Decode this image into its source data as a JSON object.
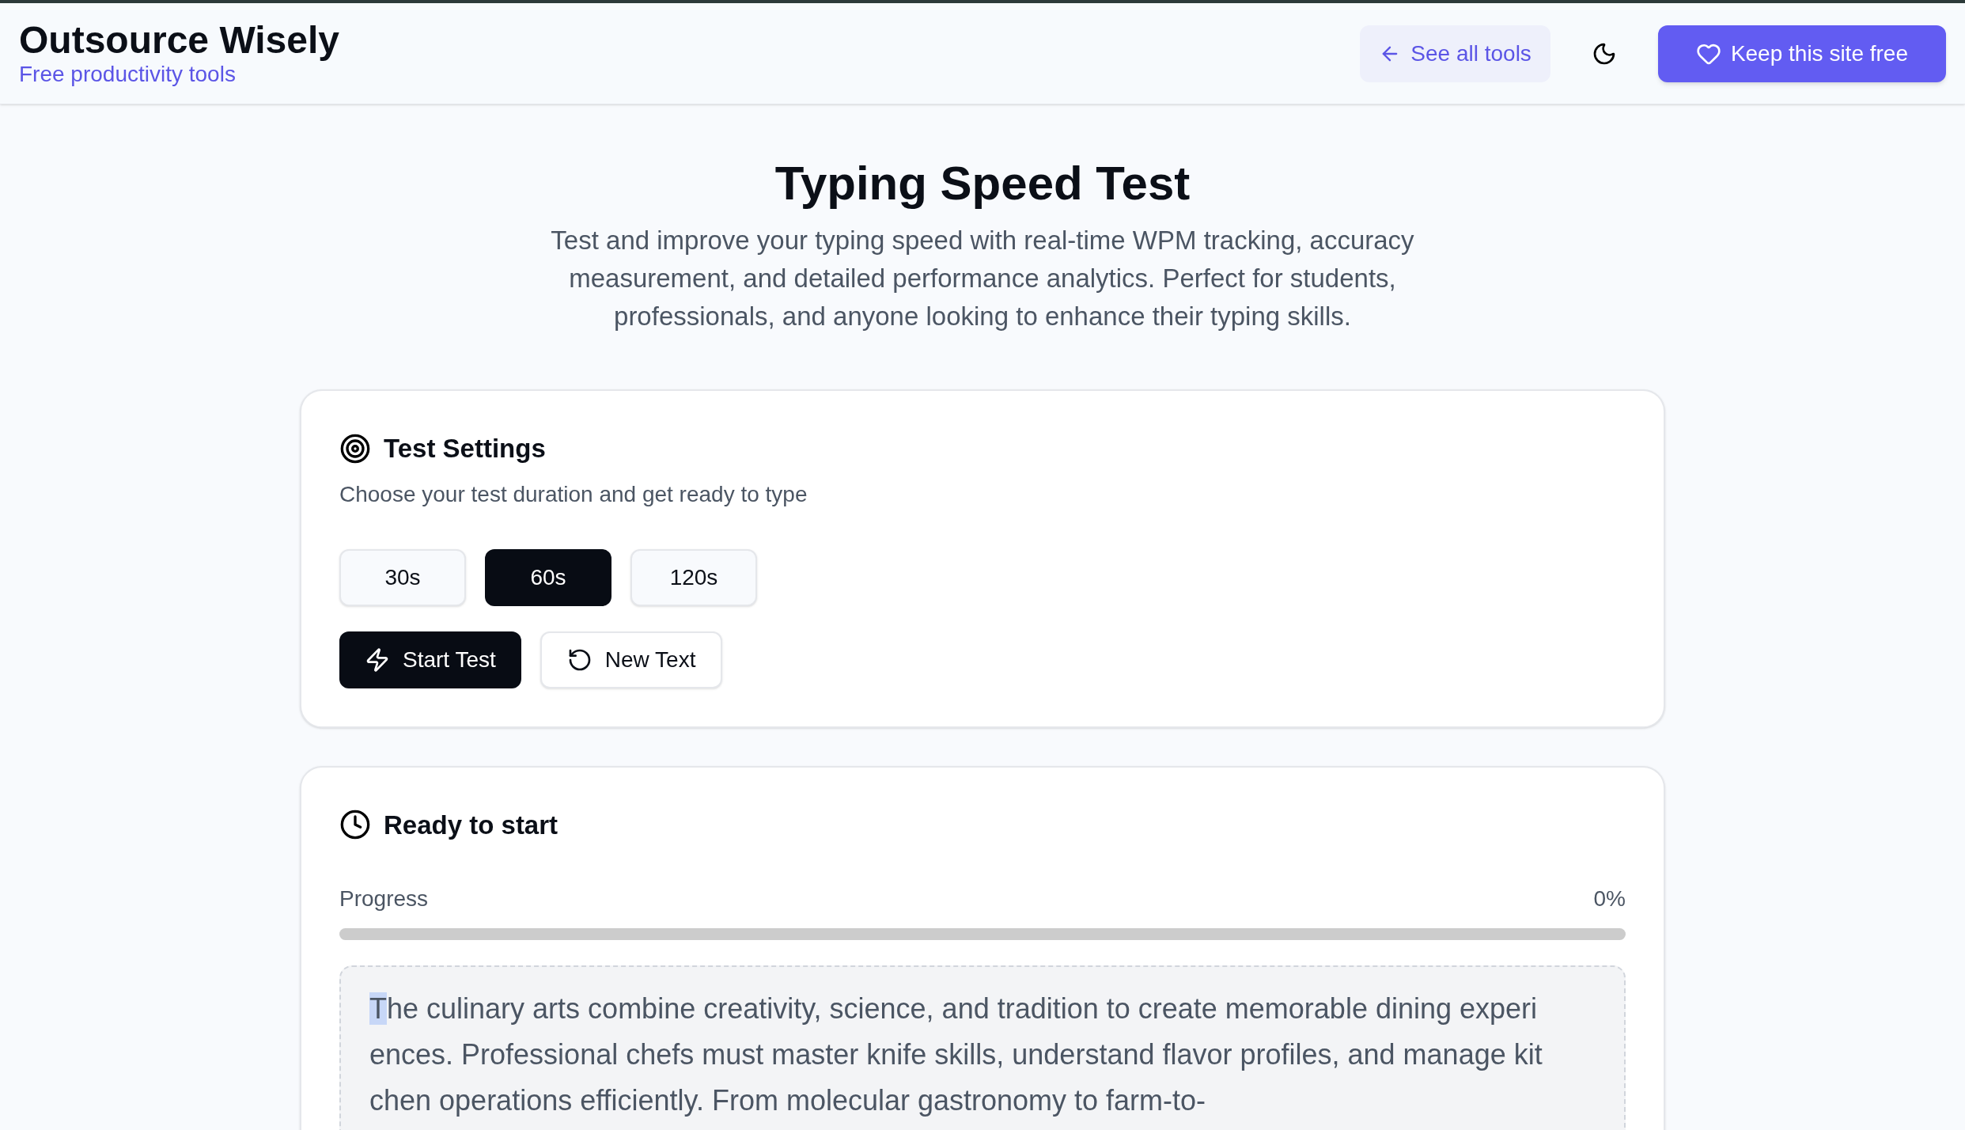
{
  "header": {
    "brand": "Outsource Wisely",
    "tagline": "Free productivity tools",
    "back_link": "See all tools",
    "support_button": "Keep this site free"
  },
  "hero": {
    "title": "Typing Speed Test",
    "description": "Test and improve your typing speed with real-time WPM tracking, accuracy measurement, and detailed performance analytics. Perfect for students, professionals, and anyone looking to enhance their typing skills."
  },
  "settings": {
    "title": "Test Settings",
    "subtitle": "Choose your test duration and get ready to type",
    "durations": [
      {
        "label": "30s",
        "selected": false
      },
      {
        "label": "60s",
        "selected": true
      },
      {
        "label": "120s",
        "selected": false
      }
    ],
    "actions": [
      {
        "label": "Start Test",
        "kind": "primary"
      },
      {
        "label": "New Text",
        "kind": "secondary"
      }
    ]
  },
  "status": {
    "title": "Ready to start",
    "progress_label": "Progress",
    "progress_reading": "0%",
    "level": 0,
    "passage": {
      "cursor": "T",
      "lines": [
        "he culinary arts combine creativity, science, and tradition to create memorable dining experi",
        "ences. Professional chefs must master knife skills, understand flavor profiles, and manage kit",
        "chen operations efficiently. From molecular gastronomy to farm-to-"
      ]
    }
  }
}
